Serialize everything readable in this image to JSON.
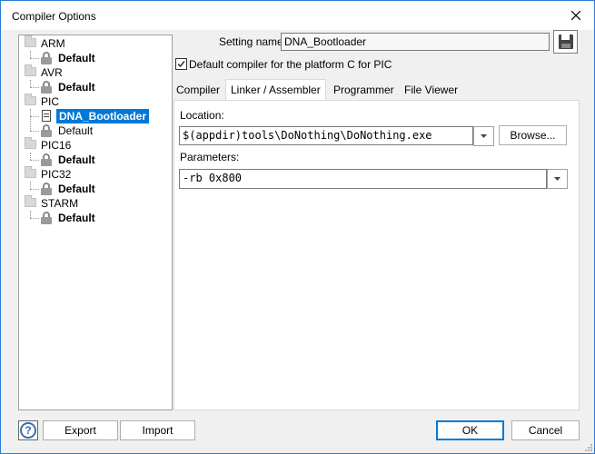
{
  "window": {
    "title": "Compiler Options"
  },
  "tree": {
    "groups": [
      {
        "name": "ARM",
        "children": [
          {
            "label": "Default",
            "bold": true
          }
        ]
      },
      {
        "name": "AVR",
        "children": [
          {
            "label": "Default",
            "bold": true
          }
        ]
      },
      {
        "name": "PIC",
        "children": [
          {
            "label": "DNA_Bootloader",
            "selected": true
          },
          {
            "label": "Default",
            "bold": false
          }
        ]
      },
      {
        "name": "PIC16",
        "children": [
          {
            "label": "Default",
            "bold": true
          }
        ]
      },
      {
        "name": "PIC32",
        "children": [
          {
            "label": "Default",
            "bold": true
          }
        ]
      },
      {
        "name": "STARM",
        "children": [
          {
            "label": "Default",
            "bold": true
          }
        ]
      }
    ]
  },
  "setting": {
    "name_label": "Setting name:",
    "name_value": "DNA_Bootloader",
    "default_checkbox_label": "Default compiler for the platform C for PIC",
    "default_checked": true
  },
  "tabs": [
    {
      "label": "Compiler",
      "active": false
    },
    {
      "label": "Linker / Assembler",
      "active": true
    },
    {
      "label": "Programmer",
      "active": false
    },
    {
      "label": "File Viewer",
      "active": false
    }
  ],
  "linker": {
    "location_label": "Location:",
    "location_value": "$(appdir)tools\\DoNothing\\DoNothing.exe",
    "browse_label": "Browse...",
    "parameters_label": "Parameters:",
    "parameters_value": "-rb 0x800"
  },
  "footer": {
    "help_glyph": "?",
    "export_label": "Export",
    "import_label": "Import",
    "ok_label": "OK",
    "cancel_label": "Cancel"
  },
  "colors": {
    "selection": "#0078d7",
    "window_border": "#2b7bd3"
  }
}
